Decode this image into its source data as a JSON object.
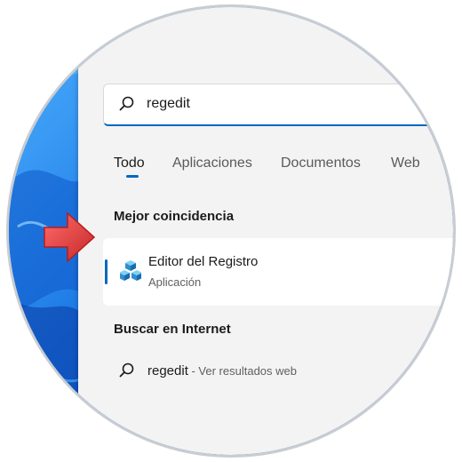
{
  "search": {
    "query": "regedit"
  },
  "tabs": [
    {
      "label": "Todo",
      "active": true
    },
    {
      "label": "Aplicaciones",
      "active": false
    },
    {
      "label": "Documentos",
      "active": false
    },
    {
      "label": "Web",
      "active": false
    }
  ],
  "best_match": {
    "section_title": "Mejor coincidencia",
    "app_name": "Editor del Registro",
    "app_type": "Aplicación",
    "icon": "registry-editor-icon"
  },
  "web_search": {
    "section_title": "Buscar en Internet",
    "query": "regedit",
    "suffix": " - Ver resultados web",
    "icon": "search-icon"
  },
  "colors": {
    "accent": "#0067c0",
    "panel": "#f3f3f3",
    "wallpaper": "#1a7ce8",
    "arrow": "#e53935"
  }
}
